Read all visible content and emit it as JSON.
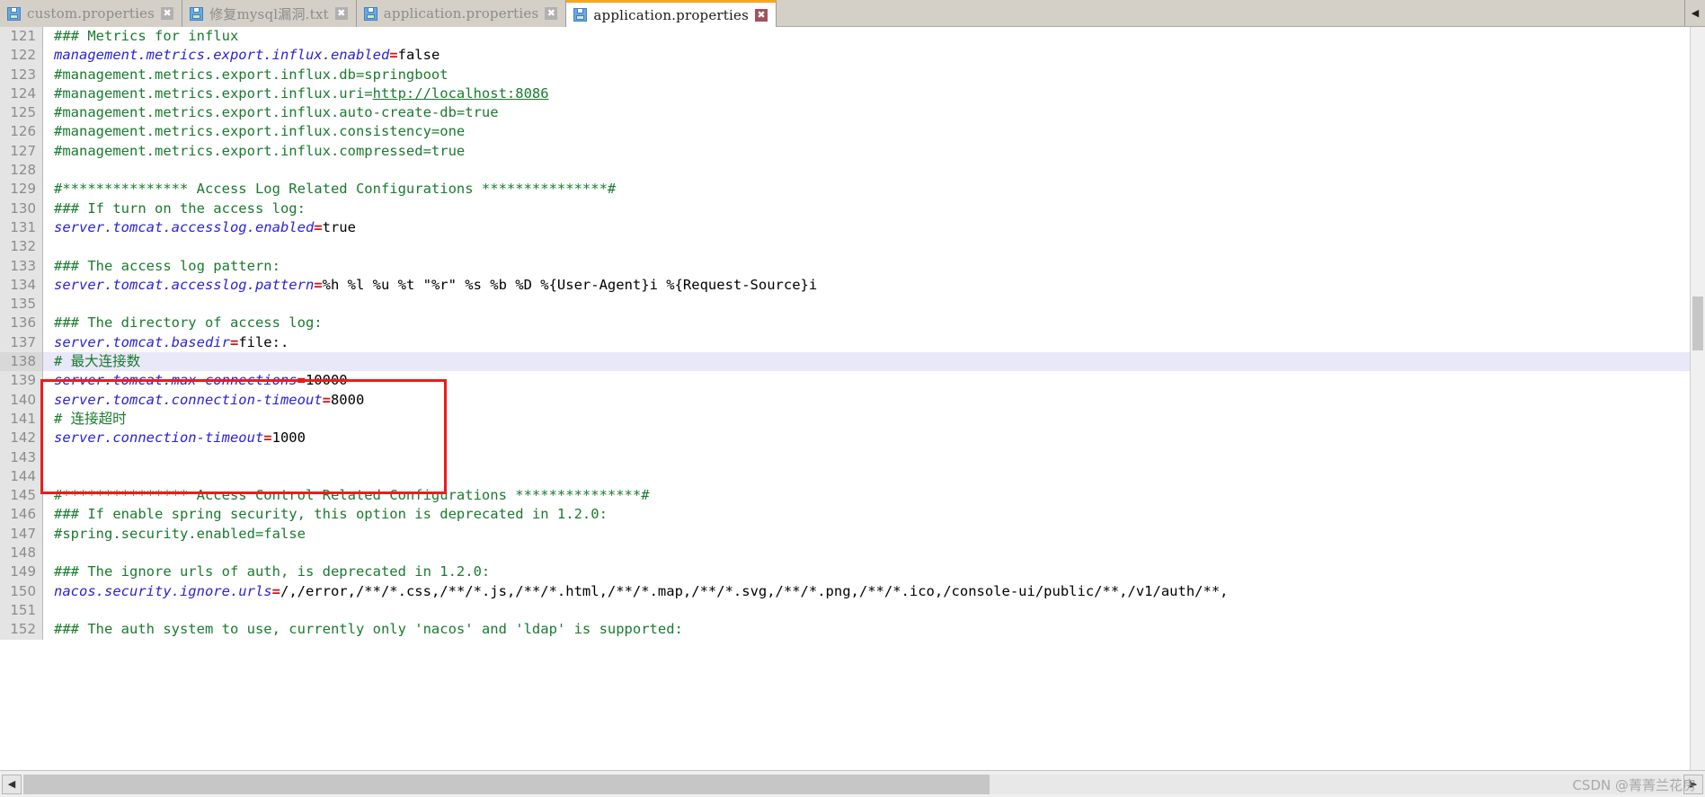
{
  "window": {
    "app_kind": "text-editor",
    "colors": {
      "active_tab_accent": "#f5a623",
      "comment_green": "#1a7a2e",
      "key_blue": "#2a22d8",
      "equals_red": "#d61111",
      "annotation_red": "#ee1b1b",
      "current_line_highlight": "#e8e8f8"
    }
  },
  "tabs": [
    {
      "label": "custom.properties",
      "icon": "floppy-disk-icon",
      "close_icon": "close-icon",
      "active": false
    },
    {
      "label": "修复mysql漏洞.txt",
      "icon": "floppy-disk-icon",
      "close_icon": "close-icon",
      "active": false
    },
    {
      "label": "application.properties",
      "icon": "floppy-disk-icon",
      "close_icon": "close-icon",
      "active": false
    },
    {
      "label": "application.properties",
      "icon": "floppy-disk-icon",
      "close_icon": "close-icon",
      "active": true
    }
  ],
  "tabbar": {
    "scroll_button_label": "◀",
    "scroll_button_icon": "chevron-left-icon"
  },
  "editor": {
    "first_line_number": 121,
    "current_line": 138,
    "lines": [
      {
        "n": 121,
        "segments": [
          {
            "t": "### Metrics for influx",
            "c": "cm"
          }
        ]
      },
      {
        "n": 122,
        "segments": [
          {
            "t": "management.metrics.export.influx.enabled",
            "c": "key"
          },
          {
            "t": "=",
            "c": "eq"
          },
          {
            "t": "false",
            "c": "val"
          }
        ]
      },
      {
        "n": 123,
        "segments": [
          {
            "t": "#management.metrics.export.influx.db=springboot",
            "c": "cm"
          }
        ]
      },
      {
        "n": 124,
        "segments": [
          {
            "t": "#management.metrics.export.influx.uri=",
            "c": "cm"
          },
          {
            "t": "http://localhost:8086",
            "c": "url"
          }
        ]
      },
      {
        "n": 125,
        "segments": [
          {
            "t": "#management.metrics.export.influx.auto-create-db=true",
            "c": "cm"
          }
        ]
      },
      {
        "n": 126,
        "segments": [
          {
            "t": "#management.metrics.export.influx.consistency=one",
            "c": "cm"
          }
        ]
      },
      {
        "n": 127,
        "segments": [
          {
            "t": "#management.metrics.export.influx.compressed=true",
            "c": "cm"
          }
        ]
      },
      {
        "n": 128,
        "segments": [
          {
            "t": "",
            "c": "val"
          }
        ]
      },
      {
        "n": 129,
        "segments": [
          {
            "t": "#*************** Access Log Related Configurations ***************#",
            "c": "cm"
          }
        ]
      },
      {
        "n": 130,
        "segments": [
          {
            "t": "### If turn on the access log:",
            "c": "cm"
          }
        ]
      },
      {
        "n": 131,
        "segments": [
          {
            "t": "server.tomcat.accesslog.enabled",
            "c": "key"
          },
          {
            "t": "=",
            "c": "eq"
          },
          {
            "t": "true",
            "c": "val"
          }
        ]
      },
      {
        "n": 132,
        "segments": [
          {
            "t": "",
            "c": "val"
          }
        ]
      },
      {
        "n": 133,
        "segments": [
          {
            "t": "### The access log pattern:",
            "c": "cm"
          }
        ]
      },
      {
        "n": 134,
        "segments": [
          {
            "t": "server.tomcat.accesslog.pattern",
            "c": "key"
          },
          {
            "t": "=",
            "c": "eq"
          },
          {
            "t": "%h %l %u %t \"%r\" %s %b %D %{User-Agent}i %{Request-Source}i",
            "c": "val"
          }
        ]
      },
      {
        "n": 135,
        "segments": [
          {
            "t": "",
            "c": "val"
          }
        ]
      },
      {
        "n": 136,
        "segments": [
          {
            "t": "### The directory of access log:",
            "c": "cm"
          }
        ]
      },
      {
        "n": 137,
        "segments": [
          {
            "t": "server.tomcat.basedir",
            "c": "key"
          },
          {
            "t": "=",
            "c": "eq"
          },
          {
            "t": "file:.",
            "c": "val"
          }
        ]
      },
      {
        "n": 138,
        "segments": [
          {
            "t": "# 最大连接数",
            "c": "cm"
          }
        ]
      },
      {
        "n": 139,
        "segments": [
          {
            "t": "server.tomcat.max-connections",
            "c": "key"
          },
          {
            "t": "=",
            "c": "eq"
          },
          {
            "t": "10000",
            "c": "val"
          }
        ]
      },
      {
        "n": 140,
        "segments": [
          {
            "t": "server.tomcat.connection-timeout",
            "c": "key"
          },
          {
            "t": "=",
            "c": "eq"
          },
          {
            "t": "8000",
            "c": "val"
          }
        ]
      },
      {
        "n": 141,
        "segments": [
          {
            "t": "# 连接超时",
            "c": "cm"
          }
        ]
      },
      {
        "n": 142,
        "segments": [
          {
            "t": "server.connection-timeout",
            "c": "key"
          },
          {
            "t": "=",
            "c": "eq"
          },
          {
            "t": "1000",
            "c": "val"
          }
        ]
      },
      {
        "n": 143,
        "segments": [
          {
            "t": "",
            "c": "val"
          }
        ]
      },
      {
        "n": 144,
        "segments": [
          {
            "t": "",
            "c": "val"
          }
        ]
      },
      {
        "n": 145,
        "segments": [
          {
            "t": "#*************** Access Control Related Configurations ***************#",
            "c": "cm"
          }
        ]
      },
      {
        "n": 146,
        "segments": [
          {
            "t": "### If enable spring security, this option is deprecated in 1.2.0:",
            "c": "cm"
          }
        ]
      },
      {
        "n": 147,
        "segments": [
          {
            "t": "#spring.security.enabled=false",
            "c": "cm"
          }
        ]
      },
      {
        "n": 148,
        "segments": [
          {
            "t": "",
            "c": "val"
          }
        ]
      },
      {
        "n": 149,
        "segments": [
          {
            "t": "### The ignore urls of auth, is deprecated in 1.2.0:",
            "c": "cm"
          }
        ]
      },
      {
        "n": 150,
        "segments": [
          {
            "t": "nacos.security.ignore.urls",
            "c": "key"
          },
          {
            "t": "=",
            "c": "eq"
          },
          {
            "t": "/,/error,/**/*.css,/**/*.js,/**/*.html,/**/*.map,/**/*.svg,/**/*.png,/**/*.ico,/console-ui/public/**,/v1/auth/**,",
            "c": "val"
          }
        ]
      },
      {
        "n": 151,
        "segments": [
          {
            "t": "",
            "c": "val"
          }
        ]
      },
      {
        "n": 152,
        "segments": [
          {
            "t": "### The auth system to use, currently only 'nacos' and 'ldap' is supported:",
            "c": "cm"
          }
        ]
      }
    ]
  },
  "statusbar": {
    "scroll_left_label": "◀",
    "scroll_right_label": "▶",
    "scroll_left_icon": "chevron-left-icon",
    "scroll_right_icon": "chevron-right-icon",
    "watermark": "CSDN @菁菁兰花房"
  }
}
